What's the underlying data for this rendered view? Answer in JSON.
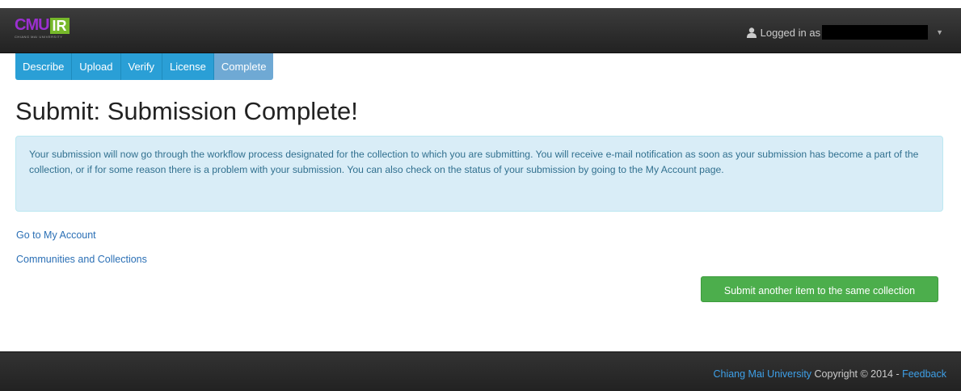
{
  "header": {
    "logo_main": "CMU",
    "logo_accent": "IR",
    "logo_sub": "CHIANG MAI UNIVERSITY",
    "logged_in_label": "Logged in as"
  },
  "steps": [
    "Describe",
    "Upload",
    "Verify",
    "License",
    "Complete"
  ],
  "page_title": "Submit: Submission Complete!",
  "alert_text": "Your submission will now go through the workflow process designated for the collection to which you are submitting. You will receive e-mail notification as soon as your submission has become a part of the collection, or if for some reason there is a problem with your submission. You can also check on the status of your submission by going to the My Account page.",
  "links": {
    "my_account": "Go to My Account",
    "communities": "Communities and Collections"
  },
  "submit_another_label": "Submit another item to the same collection",
  "footer": {
    "university_link": "Chiang Mai University",
    "copyright": " Copyright © 2014 - ",
    "feedback_link": "Feedback"
  },
  "colors": {
    "step_active": "#2a9fd6",
    "step_current": "#6fa9d4",
    "success": "#4cae4c",
    "alert_bg": "#d9edf7"
  }
}
